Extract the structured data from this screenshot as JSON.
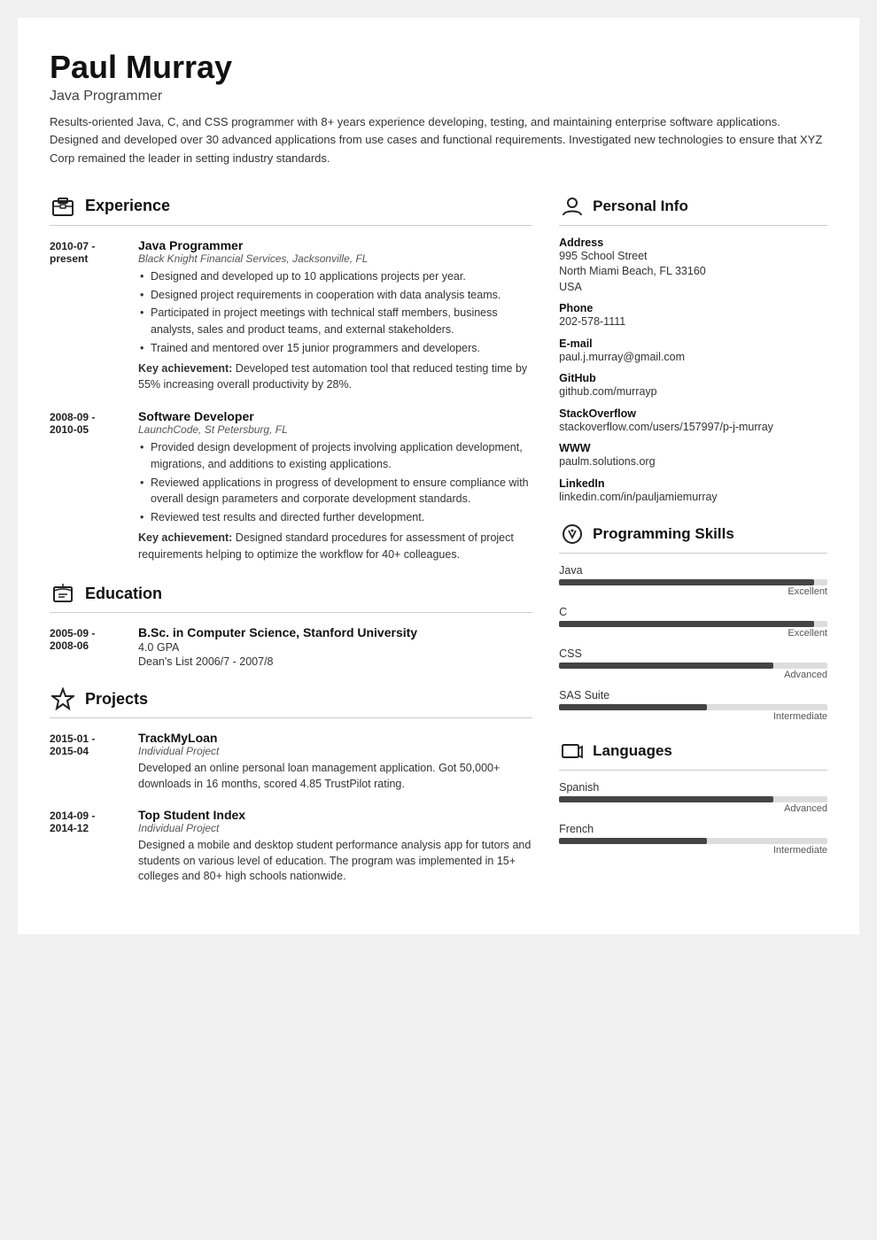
{
  "header": {
    "name": "Paul Murray",
    "title": "Java Programmer",
    "summary": "Results-oriented Java, C, and CSS programmer with 8+ years experience developing, testing, and maintaining enterprise software applications. Designed and developed over 30 advanced applications from use cases and functional requirements. Investigated new technologies to ensure that XYZ Corp remained the leader in setting industry standards."
  },
  "sections": {
    "experience_label": "Experience",
    "education_label": "Education",
    "projects_label": "Projects",
    "personal_info_label": "Personal Info",
    "programming_skills_label": "Programming Skills",
    "languages_label": "Languages"
  },
  "experience": [
    {
      "date_start": "2010-07 -",
      "date_end": "present",
      "title": "Java Programmer",
      "company": "Black Knight Financial Services, Jacksonville, FL",
      "bullets": [
        "Designed and developed up to 10 applications projects per year.",
        "Designed project requirements in cooperation with data analysis teams.",
        "Participated in project meetings with technical staff members, business analysts, sales and product teams, and external stakeholders.",
        "Trained and mentored over 15 junior programmers and developers."
      ],
      "key_achievement": "Developed test automation tool that reduced testing time by 55% increasing overall productivity by 28%."
    },
    {
      "date_start": "2008-09 -",
      "date_end": "2010-05",
      "title": "Software Developer",
      "company": "LaunchCode, St Petersburg, FL",
      "bullets": [
        "Provided design development of projects involving application development, migrations, and additions to existing applications.",
        "Reviewed applications in progress of development to ensure compliance with overall design parameters and corporate development standards.",
        "Reviewed test results and directed further development."
      ],
      "key_achievement": "Designed standard procedures for assessment of project requirements helping to optimize the workflow for 40+ colleagues."
    }
  ],
  "education": [
    {
      "date_start": "2005-09 -",
      "date_end": "2008-06",
      "degree": "B.Sc. in Computer Science, Stanford University",
      "gpa": "4.0 GPA",
      "honors": "Dean's List 2006/7 - 2007/8"
    }
  ],
  "projects": [
    {
      "date_start": "2015-01 -",
      "date_end": "2015-04",
      "title": "TrackMyLoan",
      "type": "Individual Project",
      "description": "Developed an online personal loan management application. Got 50,000+ downloads in 16 months, scored 4.85 TrustPilot rating."
    },
    {
      "date_start": "2014-09 -",
      "date_end": "2014-12",
      "title": "Top Student Index",
      "type": "Individual Project",
      "description": "Designed a mobile and desktop student performance analysis app for tutors and students on various level of education. The program was implemented in 15+ colleges and 80+ high schools nationwide."
    }
  ],
  "personal_info": {
    "address_label": "Address",
    "address_line1": "995 School Street",
    "address_line2": "North Miami Beach, FL 33160",
    "address_country": "USA",
    "phone_label": "Phone",
    "phone": "202-578-1111",
    "email_label": "E-mail",
    "email": "paul.j.murray@gmail.com",
    "github_label": "GitHub",
    "github": "github.com/murrayp",
    "stackoverflow_label": "StackOverflow",
    "stackoverflow": "stackoverflow.com/users/157997/p-j-murray",
    "www_label": "WWW",
    "www": "paulm.solutions.org",
    "linkedin_label": "LinkedIn",
    "linkedin": "linkedin.com/in/pauljamiemurray"
  },
  "skills": [
    {
      "name": "Java",
      "level": "Excellent",
      "percent": 95
    },
    {
      "name": "C",
      "level": "Excellent",
      "percent": 95
    },
    {
      "name": "CSS",
      "level": "Advanced",
      "percent": 80
    },
    {
      "name": "SAS Suite",
      "level": "Intermediate",
      "percent": 55
    }
  ],
  "languages": [
    {
      "name": "Spanish",
      "level": "Advanced",
      "percent": 80
    },
    {
      "name": "French",
      "level": "Intermediate",
      "percent": 55
    }
  ]
}
